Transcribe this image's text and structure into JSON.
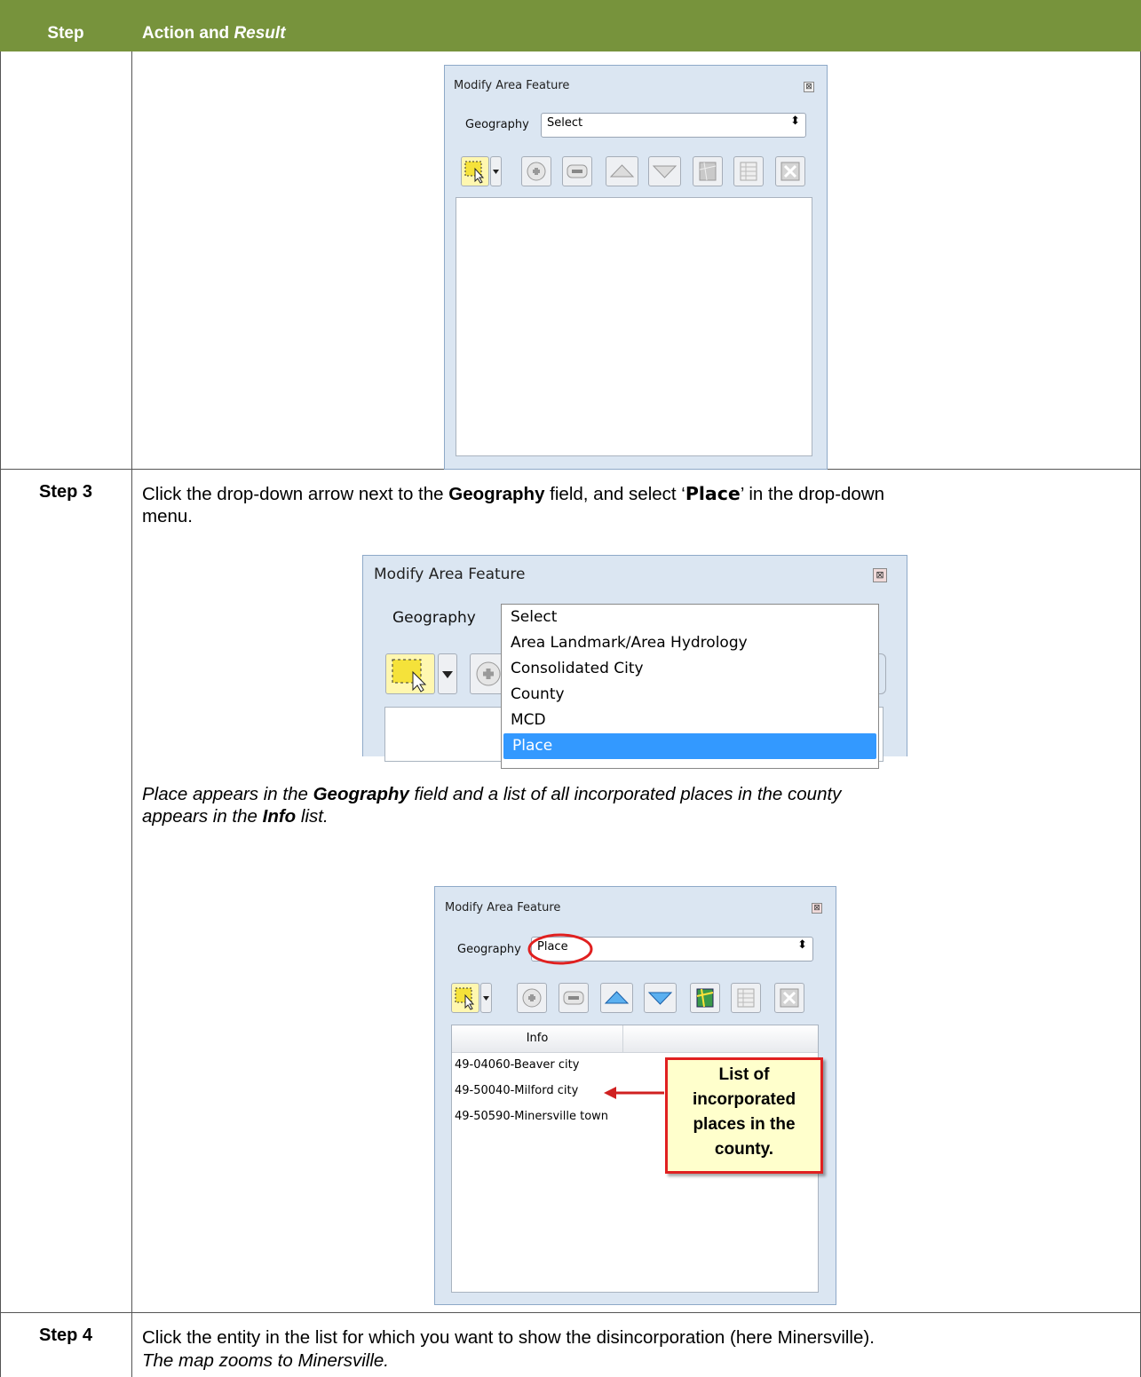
{
  "header": {
    "col_step": "Step",
    "col_action_prefix": "Action and ",
    "col_action_italic": "Result"
  },
  "dialog1": {
    "title": "Modify Area Feature",
    "geography_label": "Geography",
    "geography_value": "Select",
    "close_glyph": "⊠",
    "combo_arrow": "⬍"
  },
  "step3": {
    "label": "Step 3",
    "instr_a": "Click the drop-down arrow next to the ",
    "instr_b": "Geography",
    "instr_c": " field, and select ‘",
    "instr_d": "Place",
    "instr_e": "’ in the drop-down",
    "instr_f": "menu.",
    "result_a": "Place appears in the ",
    "result_b": "Geography",
    "result_c": " field and a list of all incorporated places in the county",
    "result_d": "appears in the ",
    "result_e": "Info",
    "result_f": " list."
  },
  "dialog2": {
    "title": "Modify Area Feature",
    "geography_label": "Geography",
    "options": [
      "Select",
      "Area Landmark/Area Hydrology",
      "Consolidated City",
      "County",
      "MCD",
      "Place"
    ],
    "selected_index": 5
  },
  "dialog3": {
    "title": "Modify Area Feature",
    "geography_label": "Geography",
    "geography_value": "Place",
    "info_header": "Info",
    "items": [
      "49-04060-Beaver city",
      "49-50040-Milford city",
      "49-50590-Minersville town"
    ],
    "callout_lines": [
      "List of",
      "incorporated",
      "places in the",
      "county."
    ]
  },
  "step4": {
    "label": "Step 4",
    "instr": "Click the entity in the list for which you want to show the disincorporation (here Minersville).",
    "result": "The map zooms to Minersville."
  },
  "colors": {
    "header_green": "#77933c",
    "selection_blue": "#3399ff",
    "callout_fill": "#ffffcc",
    "callout_border": "#e02020"
  }
}
